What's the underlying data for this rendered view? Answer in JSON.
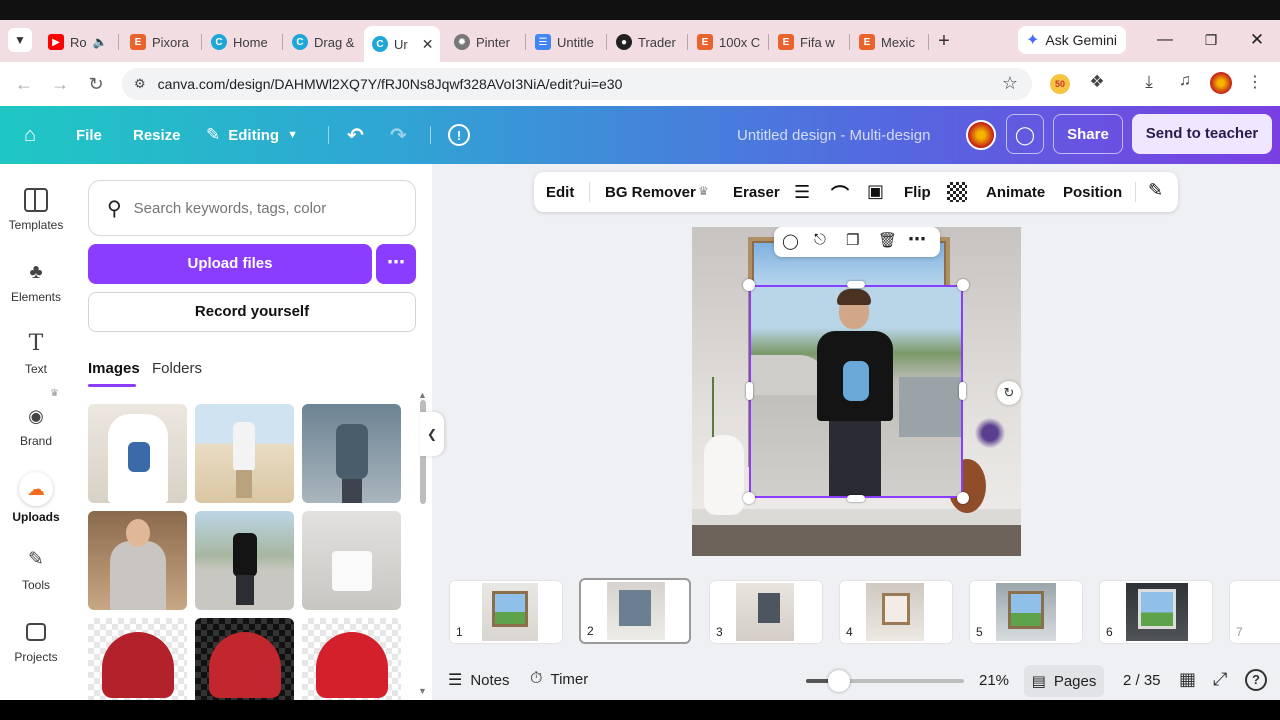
{
  "browser": {
    "tabs": [
      {
        "label": "Ro",
        "icon": "youtube-icon",
        "color": "#ff0000"
      },
      {
        "label": "Pixora",
        "icon": "e-icon",
        "color": "#e8642c"
      },
      {
        "label": "Home",
        "icon": "canva-icon",
        "color": "#1fa6d8"
      },
      {
        "label": "Drag &",
        "icon": "canva-icon",
        "color": "#1fa6d8"
      },
      {
        "label": "Ur",
        "icon": "canva-icon",
        "color": "#1fa6d8"
      },
      {
        "label": "Pinter",
        "icon": "openai-icon",
        "color": "#555555"
      },
      {
        "label": "Untitle",
        "icon": "docs-icon",
        "color": "#4285f4"
      },
      {
        "label": "Trader",
        "icon": "lightbulb-icon",
        "color": "#222222"
      },
      {
        "label": "100x C",
        "icon": "e-icon",
        "color": "#e8642c"
      },
      {
        "label": "Fifa w",
        "icon": "e-icon",
        "color": "#e8642c"
      },
      {
        "label": "Mexic",
        "icon": "e-icon",
        "color": "#e8642c"
      }
    ],
    "new_tab": "+",
    "ask_gemini": "Ask Gemini",
    "url": "canva.com/design/DAHMWl2XQ7Y/fRJ0Ns8Jqwf328AVoI3NiA/edit?ui=e30"
  },
  "header": {
    "file": "File",
    "resize": "Resize",
    "editing": "Editing",
    "title": "Untitled design - Multi-design",
    "share": "Share",
    "send": "Send to teacher"
  },
  "rail": [
    {
      "label": "Templates",
      "icon": "templates-icon"
    },
    {
      "label": "Elements",
      "icon": "elements-icon"
    },
    {
      "label": "Text",
      "icon": "text-icon"
    },
    {
      "label": "Brand",
      "icon": "brand-icon"
    },
    {
      "label": "Uploads",
      "icon": "uploads-icon"
    },
    {
      "label": "Tools",
      "icon": "tools-icon"
    },
    {
      "label": "Projects",
      "icon": "projects-icon"
    }
  ],
  "panel": {
    "search_placeholder": "Search keywords, tags, color",
    "upload": "Upload files",
    "record": "Record yourself",
    "tab_images": "Images",
    "tab_folders": "Folders"
  },
  "toolbar": {
    "edit": "Edit",
    "bg_remover": "BG Remover",
    "eraser": "Eraser",
    "flip": "Flip",
    "animate": "Animate",
    "position": "Position"
  },
  "pages": {
    "items": [
      "1",
      "2",
      "3",
      "4",
      "5",
      "6",
      "7"
    ],
    "notes": "Notes",
    "timer": "Timer",
    "zoom": "21%",
    "zoom_level": 0.21,
    "pages_btn": "Pages",
    "page_count": "2 / 35"
  },
  "colors": {
    "accent": "#8b3dff",
    "selection": "#8b3dff"
  }
}
